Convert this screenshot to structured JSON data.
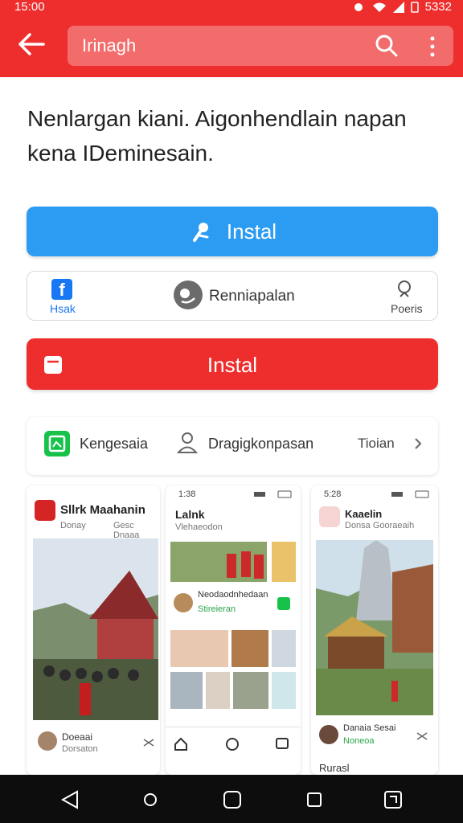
{
  "status": {
    "time": "15:00",
    "battery": "5332"
  },
  "search": {
    "value": "Irinagh"
  },
  "description": "Nenlargan kiani. Aigonhendlain napan kena IDeminesain.",
  "buttons": {
    "install_blue": "Instal",
    "install_red": "Instal"
  },
  "share_row": {
    "left_label": "Hsak",
    "middle_label": "Renniapalan",
    "right_label": "Poeris"
  },
  "tab_row": {
    "item1": "Kengesaia",
    "item2": "Dragigkonpasan",
    "item3": "Tioian"
  },
  "cards": [
    {
      "title": "Sllrk Maahanin",
      "sub1": "Donay",
      "sub2": "Gesc Dnaaa",
      "footer_name": "Doeaai",
      "footer_sub": "Dorsaton"
    },
    {
      "time": "1:38",
      "title": "Lalnk",
      "subtitle": "Vlehaeodon",
      "row_name": "Neodaodnhedaan",
      "row_sub": "Stireieran"
    },
    {
      "time": "5:28",
      "title": "Kaaelin",
      "subtitle": "Donsa Gooraeaih",
      "footer_name": "Danaia Sesai",
      "footer_sub": "Noneoa",
      "bottom_label": "Rurasl"
    }
  ],
  "colors": {
    "appbar": "#ee2d2d",
    "blue_button": "#2c9cf2",
    "red_button": "#ee2d2d",
    "facebook": "#1877f2",
    "green": "#16c24a"
  },
  "icons": [
    "back-arrow-icon",
    "search-icon",
    "more-vertical-icon",
    "microphone-icon",
    "facebook-icon",
    "chat-face-icon",
    "search-small-icon",
    "clipboard-icon",
    "gallery-app-icon",
    "user-icon",
    "chevron-right-icon",
    "home-icon",
    "chat-icon",
    "back-nav-icon",
    "home-nav-icon",
    "recents-nav-icon"
  ]
}
